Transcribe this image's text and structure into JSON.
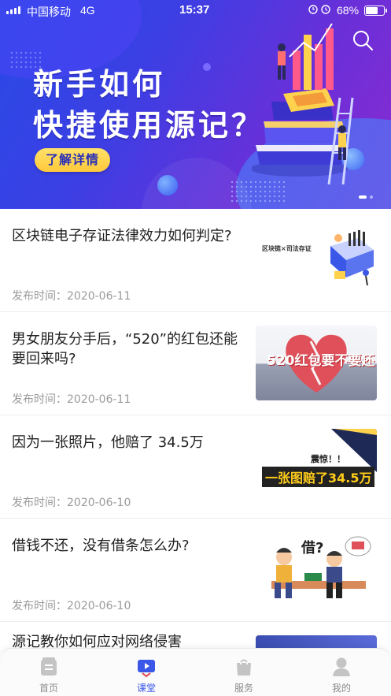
{
  "status_bar": {
    "carrier": "中国移动",
    "network": "4G",
    "time": "15:37",
    "battery": "68%",
    "battery_level": 0.68
  },
  "banner": {
    "title_line1": "新手如何",
    "title_line2": "快捷使用源记？",
    "cta_label": "了解详情",
    "pager_count": 2,
    "pager_active": 1,
    "search_icon": "search-icon"
  },
  "articles": [
    {
      "title": "区块链电子存证法律效力如何判定?",
      "date": "发布时间：2020-06-11",
      "thumb_caption": "区块链×司法存证"
    },
    {
      "title": "男女朋友分手后，“520”的红包还能要回来吗?",
      "date": "发布时间：2020-06-11",
      "thumb_caption": "520红包要不要还"
    },
    {
      "title": "因为一张照片，他赔了 34.5万",
      "date": "发布时间：2020-06-10",
      "thumb_caption_top": "震惊！！",
      "thumb_caption": "一张图赔了34.5万"
    },
    {
      "title": "借钱不还，没有借条怎么办?",
      "date": "发布时间：2020-06-10",
      "thumb_caption": "借?"
    }
  ],
  "peek_article": {
    "title": "源记教你如何应对网络侵害"
  },
  "tabbar": {
    "tabs": [
      {
        "label": "首页",
        "icon": "home-icon",
        "active": false
      },
      {
        "label": "课堂",
        "icon": "play-icon",
        "active": true
      },
      {
        "label": "服务",
        "icon": "shopping-bag-icon",
        "active": false
      },
      {
        "label": "我的",
        "icon": "user-icon",
        "active": false
      }
    ]
  },
  "colors": {
    "accent": "#3a57e8",
    "banner_start": "#2a49e6",
    "banner_end": "#8a2bd0",
    "cta": "#ffd24d"
  }
}
